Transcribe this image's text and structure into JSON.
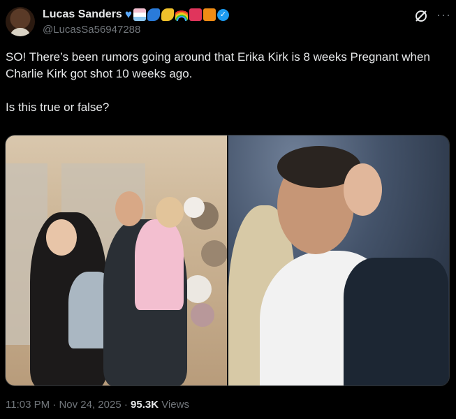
{
  "author": {
    "name": "Lucas Sanders",
    "handle": "@LucasSa56947288",
    "emoji_icons": [
      "blue-heart-icon",
      "folded-flag-icon",
      "flexed-arm-icon",
      "flexed-arm-icon",
      "rainbow-icon",
      "person-icon",
      "orange-square-icon"
    ],
    "verified": true
  },
  "tweet": {
    "line1": "SO! There’s been rumors going around that Erika Kirk is 8 weeks Pregnant when Charlie Kirk got shot 10 weeks ago.",
    "line2": "Is this true or false?"
  },
  "media": {
    "count": 2
  },
  "footer": {
    "time": "11:03 PM",
    "separator1": " · ",
    "date": "Nov 24, 2025",
    "separator2": " · ",
    "views_count": "95.3K",
    "views_label": " Views"
  },
  "colors": {
    "background": "#000000",
    "text": "#e7e9ea",
    "muted": "#71767b",
    "verified": "#1d9bf0"
  }
}
